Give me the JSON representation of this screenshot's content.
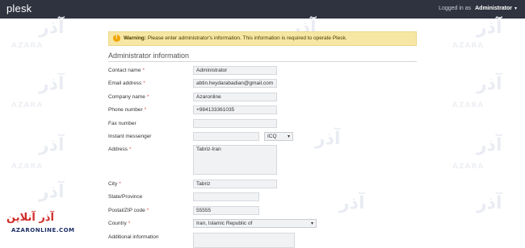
{
  "topbar": {
    "logo": "plesk",
    "logged_in_as": "Logged in as",
    "user": "Administrator",
    "user_caret": "▾"
  },
  "watermark": {
    "text": "آذر",
    "sub": "AZARA"
  },
  "warning": {
    "bold": "Warning:",
    "message": " Please enter administrator's information. This information is required to operate Plesk."
  },
  "section": {
    "title": "Administrator information"
  },
  "required_marker": "*",
  "form": {
    "contact_name": {
      "label": "Contact name",
      "value": "Administrator"
    },
    "email": {
      "label": "Email address",
      "value": "abtin.heydarabadian@gmail.com"
    },
    "company": {
      "label": "Company name",
      "value": "Azaronline"
    },
    "phone": {
      "label": "Phone number",
      "value": "+984133361035"
    },
    "fax": {
      "label": "Fax number",
      "value": ""
    },
    "im": {
      "label": "Instant messenger",
      "value": "",
      "type": "ICQ",
      "type_caret": "▾"
    },
    "address": {
      "label": "Address",
      "value": "Tabriz-Iran"
    },
    "city": {
      "label": "City",
      "value": "Tabriz"
    },
    "state": {
      "label": "State/Province",
      "value": ""
    },
    "zip": {
      "label": "Postal/ZIP code",
      "value": "55555"
    },
    "country": {
      "label": "Country",
      "value": "Iran, Islamic Republic of",
      "caret": "▾"
    },
    "additional": {
      "label": "Additional information",
      "value": ""
    }
  },
  "badge": {
    "name": "آذر آنلاین",
    "domain": "AZARONLINE.COM"
  }
}
